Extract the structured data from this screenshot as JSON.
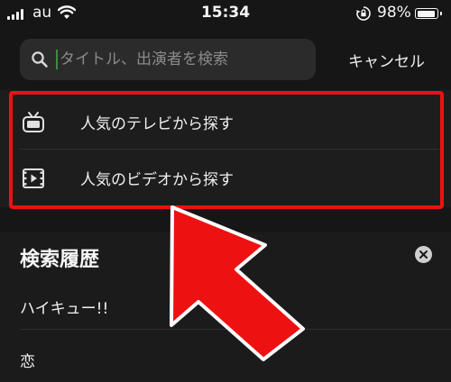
{
  "status_bar": {
    "carrier": "au",
    "time": "15:34",
    "battery_percent": "98%",
    "battery_level": 0.98,
    "icons": [
      "signal-icon",
      "wifi-icon",
      "rotation-lock-icon",
      "battery-icon"
    ]
  },
  "search": {
    "placeholder": "タイトル、出演者を検索",
    "value": "",
    "cancel_label": "キャンセル"
  },
  "browse": {
    "items": [
      {
        "label": "人気のテレビから探す",
        "icon": "tv-icon"
      },
      {
        "label": "人気のビデオから探す",
        "icon": "video-icon"
      }
    ]
  },
  "history": {
    "title": "検索履歴",
    "clear_icon": "clear-icon",
    "items": [
      "ハイキュー!!",
      "恋"
    ]
  },
  "annotation": {
    "color": "#ee1111"
  }
}
